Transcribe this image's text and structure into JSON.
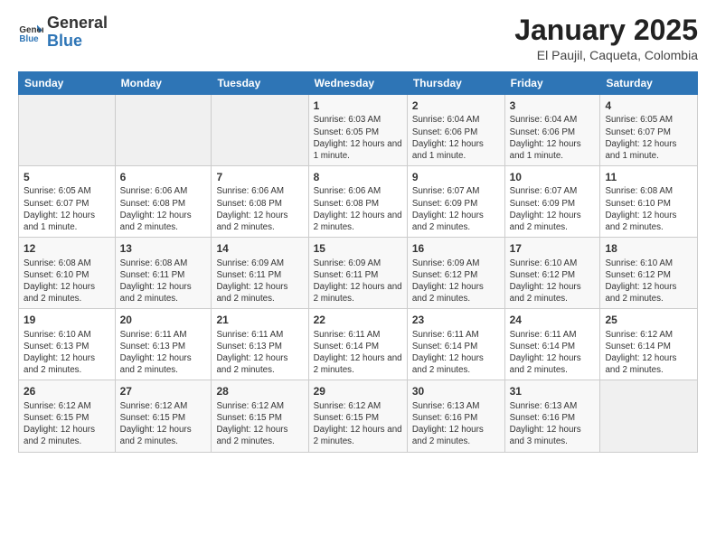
{
  "logo": {
    "text_general": "General",
    "text_blue": "Blue"
  },
  "header": {
    "title": "January 2025",
    "subtitle": "El Paujil, Caqueta, Colombia"
  },
  "weekdays": [
    "Sunday",
    "Monday",
    "Tuesday",
    "Wednesday",
    "Thursday",
    "Friday",
    "Saturday"
  ],
  "weeks": [
    [
      {
        "day": "",
        "detail": ""
      },
      {
        "day": "",
        "detail": ""
      },
      {
        "day": "",
        "detail": ""
      },
      {
        "day": "1",
        "detail": "Sunrise: 6:03 AM\nSunset: 6:05 PM\nDaylight: 12 hours and 1 minute."
      },
      {
        "day": "2",
        "detail": "Sunrise: 6:04 AM\nSunset: 6:06 PM\nDaylight: 12 hours and 1 minute."
      },
      {
        "day": "3",
        "detail": "Sunrise: 6:04 AM\nSunset: 6:06 PM\nDaylight: 12 hours and 1 minute."
      },
      {
        "day": "4",
        "detail": "Sunrise: 6:05 AM\nSunset: 6:07 PM\nDaylight: 12 hours and 1 minute."
      }
    ],
    [
      {
        "day": "5",
        "detail": "Sunrise: 6:05 AM\nSunset: 6:07 PM\nDaylight: 12 hours and 1 minute."
      },
      {
        "day": "6",
        "detail": "Sunrise: 6:06 AM\nSunset: 6:08 PM\nDaylight: 12 hours and 2 minutes."
      },
      {
        "day": "7",
        "detail": "Sunrise: 6:06 AM\nSunset: 6:08 PM\nDaylight: 12 hours and 2 minutes."
      },
      {
        "day": "8",
        "detail": "Sunrise: 6:06 AM\nSunset: 6:08 PM\nDaylight: 12 hours and 2 minutes."
      },
      {
        "day": "9",
        "detail": "Sunrise: 6:07 AM\nSunset: 6:09 PM\nDaylight: 12 hours and 2 minutes."
      },
      {
        "day": "10",
        "detail": "Sunrise: 6:07 AM\nSunset: 6:09 PM\nDaylight: 12 hours and 2 minutes."
      },
      {
        "day": "11",
        "detail": "Sunrise: 6:08 AM\nSunset: 6:10 PM\nDaylight: 12 hours and 2 minutes."
      }
    ],
    [
      {
        "day": "12",
        "detail": "Sunrise: 6:08 AM\nSunset: 6:10 PM\nDaylight: 12 hours and 2 minutes."
      },
      {
        "day": "13",
        "detail": "Sunrise: 6:08 AM\nSunset: 6:11 PM\nDaylight: 12 hours and 2 minutes."
      },
      {
        "day": "14",
        "detail": "Sunrise: 6:09 AM\nSunset: 6:11 PM\nDaylight: 12 hours and 2 minutes."
      },
      {
        "day": "15",
        "detail": "Sunrise: 6:09 AM\nSunset: 6:11 PM\nDaylight: 12 hours and 2 minutes."
      },
      {
        "day": "16",
        "detail": "Sunrise: 6:09 AM\nSunset: 6:12 PM\nDaylight: 12 hours and 2 minutes."
      },
      {
        "day": "17",
        "detail": "Sunrise: 6:10 AM\nSunset: 6:12 PM\nDaylight: 12 hours and 2 minutes."
      },
      {
        "day": "18",
        "detail": "Sunrise: 6:10 AM\nSunset: 6:12 PM\nDaylight: 12 hours and 2 minutes."
      }
    ],
    [
      {
        "day": "19",
        "detail": "Sunrise: 6:10 AM\nSunset: 6:13 PM\nDaylight: 12 hours and 2 minutes."
      },
      {
        "day": "20",
        "detail": "Sunrise: 6:11 AM\nSunset: 6:13 PM\nDaylight: 12 hours and 2 minutes."
      },
      {
        "day": "21",
        "detail": "Sunrise: 6:11 AM\nSunset: 6:13 PM\nDaylight: 12 hours and 2 minutes."
      },
      {
        "day": "22",
        "detail": "Sunrise: 6:11 AM\nSunset: 6:14 PM\nDaylight: 12 hours and 2 minutes."
      },
      {
        "day": "23",
        "detail": "Sunrise: 6:11 AM\nSunset: 6:14 PM\nDaylight: 12 hours and 2 minutes."
      },
      {
        "day": "24",
        "detail": "Sunrise: 6:11 AM\nSunset: 6:14 PM\nDaylight: 12 hours and 2 minutes."
      },
      {
        "day": "25",
        "detail": "Sunrise: 6:12 AM\nSunset: 6:14 PM\nDaylight: 12 hours and 2 minutes."
      }
    ],
    [
      {
        "day": "26",
        "detail": "Sunrise: 6:12 AM\nSunset: 6:15 PM\nDaylight: 12 hours and 2 minutes."
      },
      {
        "day": "27",
        "detail": "Sunrise: 6:12 AM\nSunset: 6:15 PM\nDaylight: 12 hours and 2 minutes."
      },
      {
        "day": "28",
        "detail": "Sunrise: 6:12 AM\nSunset: 6:15 PM\nDaylight: 12 hours and 2 minutes."
      },
      {
        "day": "29",
        "detail": "Sunrise: 6:12 AM\nSunset: 6:15 PM\nDaylight: 12 hours and 2 minutes."
      },
      {
        "day": "30",
        "detail": "Sunrise: 6:13 AM\nSunset: 6:16 PM\nDaylight: 12 hours and 2 minutes."
      },
      {
        "day": "31",
        "detail": "Sunrise: 6:13 AM\nSunset: 6:16 PM\nDaylight: 12 hours and 3 minutes."
      },
      {
        "day": "",
        "detail": ""
      }
    ]
  ]
}
